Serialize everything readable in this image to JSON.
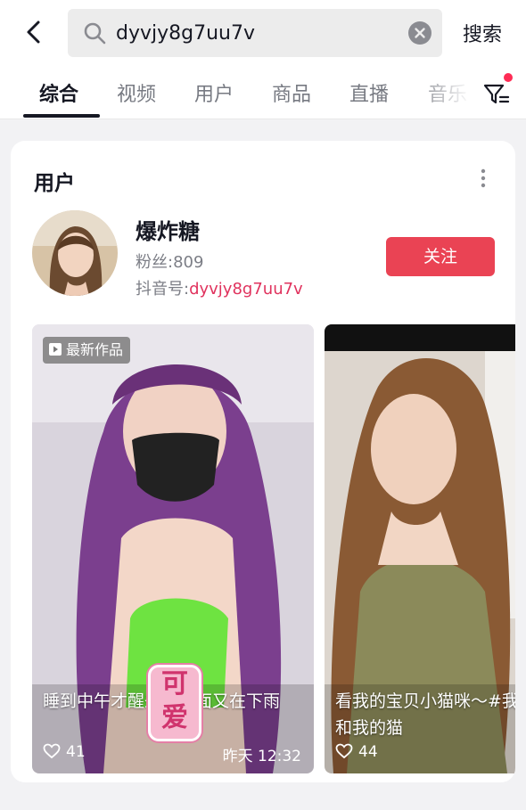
{
  "search": {
    "query": "dyvjy8g7uu7v",
    "submit_label": "搜索"
  },
  "tabs": [
    {
      "label": "综合",
      "active": true
    },
    {
      "label": "视频",
      "active": false
    },
    {
      "label": "用户",
      "active": false
    },
    {
      "label": "商品",
      "active": false
    },
    {
      "label": "直播",
      "active": false
    },
    {
      "label": "音乐",
      "active": false
    }
  ],
  "user_section": {
    "title": "用户",
    "user": {
      "name": "爆炸糖",
      "fans_label": "粉丝:",
      "fans_count": "809",
      "id_label": "抖音号:",
      "id_value": "dyvjy8g7uu7v",
      "follow_label": "关注"
    },
    "videos": [
      {
        "badge": "最新作品",
        "caption": "睡到中午才醒来，外面又在下雨",
        "likes": "41",
        "time": "昨天 12:32",
        "sticker": [
          "可",
          "爱"
        ]
      },
      {
        "caption": "看我的宝贝小猫咪～#我和我的猫",
        "likes": "44"
      }
    ]
  },
  "colors": {
    "accent": "#fe2c55",
    "follow_button": "#ea4354",
    "id_text": "#e0325d"
  },
  "icons": {
    "back": "chevron-left-icon",
    "search": "search-icon",
    "clear": "clear-icon",
    "filter": "filter-icon",
    "more": "more-vertical-icon",
    "badge": "video-play-icon",
    "likes": "heart-icon"
  }
}
